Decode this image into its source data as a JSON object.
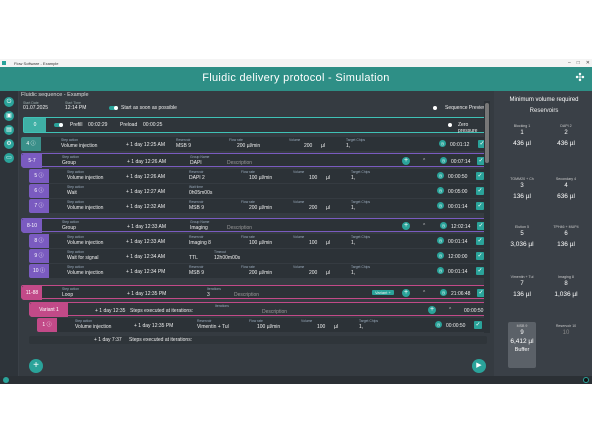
{
  "window": {
    "title": "Flow Software - Example"
  },
  "header": {
    "title": "Fluidic delivery protocol - Simulation"
  },
  "sequence": {
    "title": "Fluidic sequence - Example",
    "start_date_label": "Start Date",
    "start_date": "01.07.2025",
    "start_time_label": "Start Time",
    "start_time": "12:14 PM",
    "asap_label": "Start as soon as possible",
    "preview_label": "Sequence Preview"
  },
  "prefill": {
    "index": "0",
    "prefill_label": "Prefill",
    "prefill_time": "00:02:29",
    "preload_label": "Preload",
    "preload_time": "00:00:25",
    "zero_label": "Zero pressure"
  },
  "labels": {
    "step_action": "Step action",
    "start_time": "Start time",
    "reservoir": "Reservoir",
    "flow_rate": "Flow rate",
    "volume": "Volume",
    "target_chips": "Target Chips",
    "group_name": "Group Name",
    "wait_time": "Wait time",
    "timeout": "Timeout",
    "iterations": "Iterations",
    "description": "Description",
    "steps_exec": "Steps executed at iterations:",
    "variant_btn": "Variant +"
  },
  "rows": [
    {
      "num": "4",
      "action": "Volume injection",
      "time": "+ 1 day 12:25 AM",
      "reservoir": "MSB 9",
      "flow": "200 µl/min",
      "volume": "200",
      "unit": "µl",
      "chips": "1,",
      "duration": "00:01:12"
    },
    {
      "num": "5-7",
      "action": "Group",
      "time": "+ 1 day 12:26 AM",
      "group": "DAPI",
      "duration": "00:07:14"
    },
    {
      "num": "5",
      "action": "Volume injection",
      "time": "+ 1 day 12:26 AM",
      "reservoir": "DAPI 2",
      "flow": "100 µl/min",
      "volume": "100",
      "unit": "µl",
      "chips": "1,",
      "duration": "00:00:50"
    },
    {
      "num": "6",
      "action": "Wait",
      "time": "+ 1 day 12:27 AM",
      "wait": "0h05m00s",
      "duration": "00:05:00"
    },
    {
      "num": "7",
      "action": "Volume injection",
      "time": "+ 1 day 12:32 AM",
      "reservoir": "MSB 9",
      "flow": "200 µl/min",
      "volume": "200",
      "unit": "µl",
      "chips": "1,",
      "duration": "00:01:14"
    },
    {
      "num": "8-10",
      "action": "Group",
      "time": "+ 1 day 12:33 AM",
      "group": "Imaging",
      "duration": "12:02:14"
    },
    {
      "num": "8",
      "action": "Volume injection",
      "time": "+ 1 day 12:33 AM",
      "reservoir": "Imaging 8",
      "flow": "100 µl/min",
      "volume": "100",
      "unit": "µl",
      "chips": "1,",
      "duration": "00:01:14"
    },
    {
      "num": "9",
      "action": "Wait for signal",
      "time": "+ 1 day 12:34 AM",
      "reservoir": "TTL",
      "timeout": "12h00m00s",
      "duration": "12:00:00"
    },
    {
      "num": "10",
      "action": "Volume injection",
      "time": "+ 1 day 12:34 PM",
      "reservoir": "MSB 9",
      "flow": "200 µl/min",
      "volume": "200",
      "unit": "µl",
      "chips": "1,",
      "duration": "00:01:14"
    },
    {
      "num": "11-88",
      "action": "Loop",
      "time": "+ 1 day 12:35 PM",
      "iterations": "3",
      "duration": "21:06:48"
    }
  ],
  "variant": {
    "label": "Variant 1",
    "time": "+ 1 day 12:35",
    "duration": "00:00:50"
  },
  "variant_step": {
    "num": "1",
    "action": "Volume injection",
    "time": "+ 1 day 12:35 PM",
    "reservoir": "Vimentin + Tul",
    "flow": "100 µl/min",
    "volume": "100",
    "unit": "µl",
    "chips": "1,",
    "duration": "00:00:50"
  },
  "partial_row": {
    "label": "Variant 2",
    "time": "+ 1 day 7:37",
    "text": "Steps executed at iterations:"
  },
  "reservoirs_panel": {
    "title": "Minimum volume required",
    "subtitle": "Reservoirs",
    "items": [
      {
        "name": "Blocking 1",
        "index": "1",
        "volume": "436 µl"
      },
      {
        "name": "DAPI 2",
        "index": "2",
        "volume": "436 µl"
      },
      {
        "name": "TOMM20 + Ch",
        "index": "3",
        "volume": "136 µl"
      },
      {
        "name": "Secondary 4",
        "index": "4",
        "volume": "636 µl"
      },
      {
        "name": "Elution 5",
        "index": "5",
        "volume": "3,036 µl"
      },
      {
        "name": "TPH46 + MUP4",
        "index": "6",
        "volume": "136 µl"
      },
      {
        "name": "Vimentin + Tul",
        "index": "7",
        "volume": "136 µl"
      },
      {
        "name": "Imaging 8",
        "index": "8",
        "volume": "1,036 µl"
      },
      {
        "name": "MSB 9",
        "index": "9",
        "volume": "6,412 µl",
        "extra": "Buffer"
      },
      {
        "name": "Reservoir 10",
        "index": "10",
        "volume": ""
      }
    ]
  }
}
